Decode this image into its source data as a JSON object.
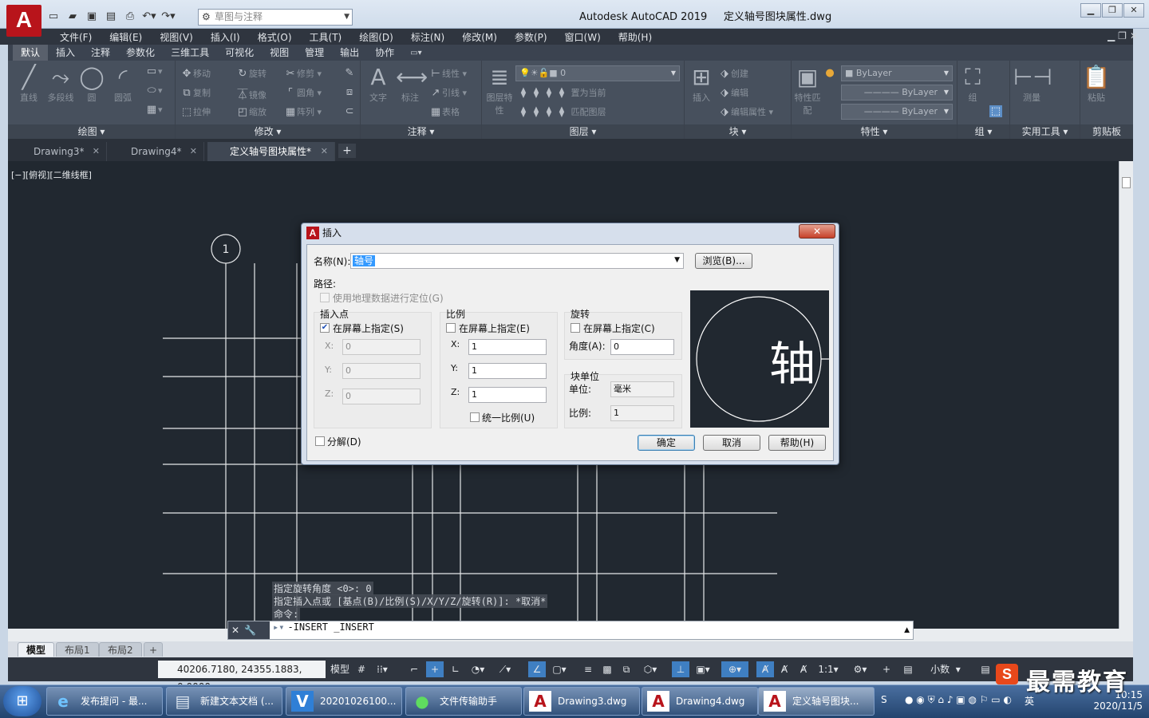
{
  "app": {
    "logo": "A",
    "title": "Autodesk AutoCAD 2019",
    "file": "定义轴号图块属性.dwg",
    "workspace_placeholder": "草图与注释"
  },
  "qat": [
    "new",
    "open",
    "save",
    "save-as",
    "plot",
    "undo",
    "redo"
  ],
  "menu": [
    "文件(F)",
    "编辑(E)",
    "视图(V)",
    "插入(I)",
    "格式(O)",
    "工具(T)",
    "绘图(D)",
    "标注(N)",
    "修改(M)",
    "参数(P)",
    "窗口(W)",
    "帮助(H)"
  ],
  "ribbon_tabs": [
    "默认",
    "插入",
    "注释",
    "参数化",
    "三维工具",
    "可视化",
    "视图",
    "管理",
    "输出",
    "协作"
  ],
  "ribbon_panels": {
    "draw": {
      "title": "绘图",
      "tools": [
        "直线",
        "多段线",
        "圆",
        "圆弧"
      ]
    },
    "modify": {
      "title": "修改",
      "tools": [
        "移动",
        "旋转",
        "修剪",
        "复制",
        "镜像",
        "圆角",
        "拉伸",
        "缩放",
        "阵列"
      ]
    },
    "annotation": {
      "title": "注释",
      "tools": [
        "文字",
        "标注",
        "线性",
        "引线",
        "表格"
      ]
    },
    "layers": {
      "title": "图层",
      "tools": [
        "图层特性",
        "置为当前",
        "匹配图层"
      ],
      "current_layer": "0"
    },
    "block": {
      "title": "块",
      "tools": [
        "插入",
        "创建",
        "编辑",
        "编辑属性"
      ]
    },
    "properties": {
      "title": "特性",
      "tools": [
        "特性匹配"
      ],
      "color": "ByLayer",
      "linetype": "ByLayer",
      "lineweight": "ByLayer"
    },
    "groups": {
      "title": "组",
      "tools": [
        "组"
      ]
    },
    "utilities": {
      "title": "实用工具",
      "tools": [
        "测量"
      ]
    },
    "clipboard": {
      "title": "剪贴板",
      "tools": [
        "粘贴"
      ]
    }
  },
  "doc_tabs": [
    "Drawing3*",
    "Drawing4*",
    "定义轴号图块属性*"
  ],
  "view_label": "[−][俯视][二维线框]",
  "drawing": {
    "axis_bubble": "1"
  },
  "command": {
    "history": [
      "指定旋转角度 <0>: 0",
      "指定插入点或 [基点(B)/比例(S)/X/Y/Z/旋转(R)]: *取消*",
      "命令:"
    ],
    "input": "-INSERT _INSERT"
  },
  "layout_tabs": [
    "模型",
    "布局1",
    "布局2"
  ],
  "status": {
    "coords": "40206.7180, 24355.1883, 0.0000",
    "model": "模型",
    "scale": "1:1",
    "units": "小数"
  },
  "dialog": {
    "title": "插入",
    "name_label": "名称(N):",
    "name_value": "轴号",
    "browse": "浏览(B)...",
    "path_label": "路径:",
    "geo_label": "使用地理数据进行定位(G)",
    "insertion": {
      "title": "插入点",
      "specify": "在屏幕上指定(S)",
      "x_label": "X:",
      "y_label": "Y:",
      "z_label": "Z:",
      "x": "0",
      "y": "0",
      "z": "0"
    },
    "scale": {
      "title": "比例",
      "specify": "在屏幕上指定(E)",
      "x_label": "X:",
      "y_label": "Y:",
      "z_label": "Z:",
      "x": "1",
      "y": "1",
      "z": "1",
      "uniform": "统一比例(U)"
    },
    "rotation": {
      "title": "旋转",
      "specify": "在屏幕上指定(C)",
      "angle_label": "角度(A):",
      "angle": "0"
    },
    "block_unit": {
      "title": "块单位",
      "unit_label": "单位:",
      "unit": "毫米",
      "factor_label": "比例:",
      "factor": "1"
    },
    "explode": "分解(D)",
    "preview_char": "轴",
    "ok": "确定",
    "cancel": "取消",
    "help": "帮助(H)"
  },
  "taskbar": {
    "items": [
      "发布提问 - 最...",
      "新建文本文档 (...",
      "20201026100...",
      "文件传输助手",
      "Drawing3.dwg",
      "Drawing4.dwg",
      "定义轴号图块..."
    ],
    "time": "10:15",
    "date": "2020/11/5",
    "ime": "英"
  },
  "watermark": "最需教育",
  "colors": {
    "canvas": "#212830",
    "ribbon": "#47505d",
    "accent": "#b8141b"
  }
}
